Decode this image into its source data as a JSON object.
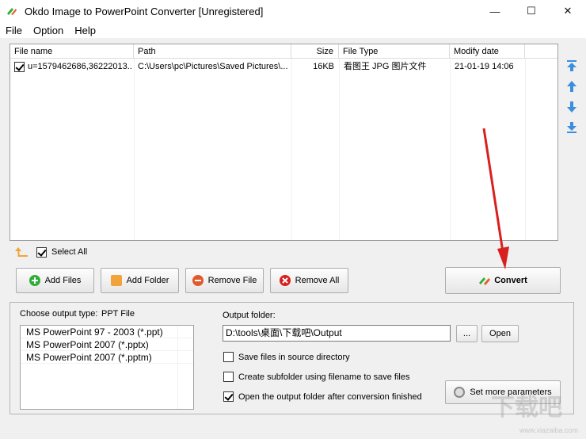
{
  "window": {
    "title": "Okdo Image to PowerPoint Converter [Unregistered]",
    "min_glyph": "—",
    "max_glyph": "☐",
    "close_glyph": "✕"
  },
  "menu": [
    "File",
    "Option",
    "Help"
  ],
  "filelist": {
    "columns": [
      "File name",
      "Path",
      "Size",
      "File Type",
      "Modify date"
    ],
    "rows": [
      {
        "checked": true,
        "name": "u=1579462686,36222013...",
        "path": "C:\\Users\\pc\\Pictures\\Saved Pictures\\...",
        "size": "16KB",
        "type": "看图王 JPG 图片文件",
        "date": "21-01-19 14:06"
      }
    ]
  },
  "select_all_label": "Select All",
  "buttons": {
    "add_files": "Add Files",
    "add_folder": "Add Folder",
    "remove_file": "Remove File",
    "remove_all": "Remove All",
    "convert": "Convert",
    "browse": "...",
    "open": "Open",
    "set_more": "Set more parameters"
  },
  "output": {
    "type_label": "Choose output type:",
    "type_value": "PPT File",
    "types": [
      "MS PowerPoint 97 - 2003 (*.ppt)",
      "MS PowerPoint 2007 (*.pptx)",
      "MS PowerPoint 2007 (*.pptm)"
    ],
    "folder_label": "Output folder:",
    "folder_value": "D:\\tools\\桌面\\下载吧\\Output",
    "options": [
      {
        "label": "Save files in source directory",
        "checked": false
      },
      {
        "label": "Create subfolder using filename to save files",
        "checked": false
      },
      {
        "label": "Open the output folder after conversion finished",
        "checked": true
      }
    ]
  },
  "watermark": {
    "text": "下载吧",
    "url": "www.xiazaiba.com"
  },
  "colors": {
    "accent_blue": "#3b8ee0",
    "arrow_red": "#d8201f",
    "green": "#2fae37",
    "orange": "#f2a43a"
  }
}
